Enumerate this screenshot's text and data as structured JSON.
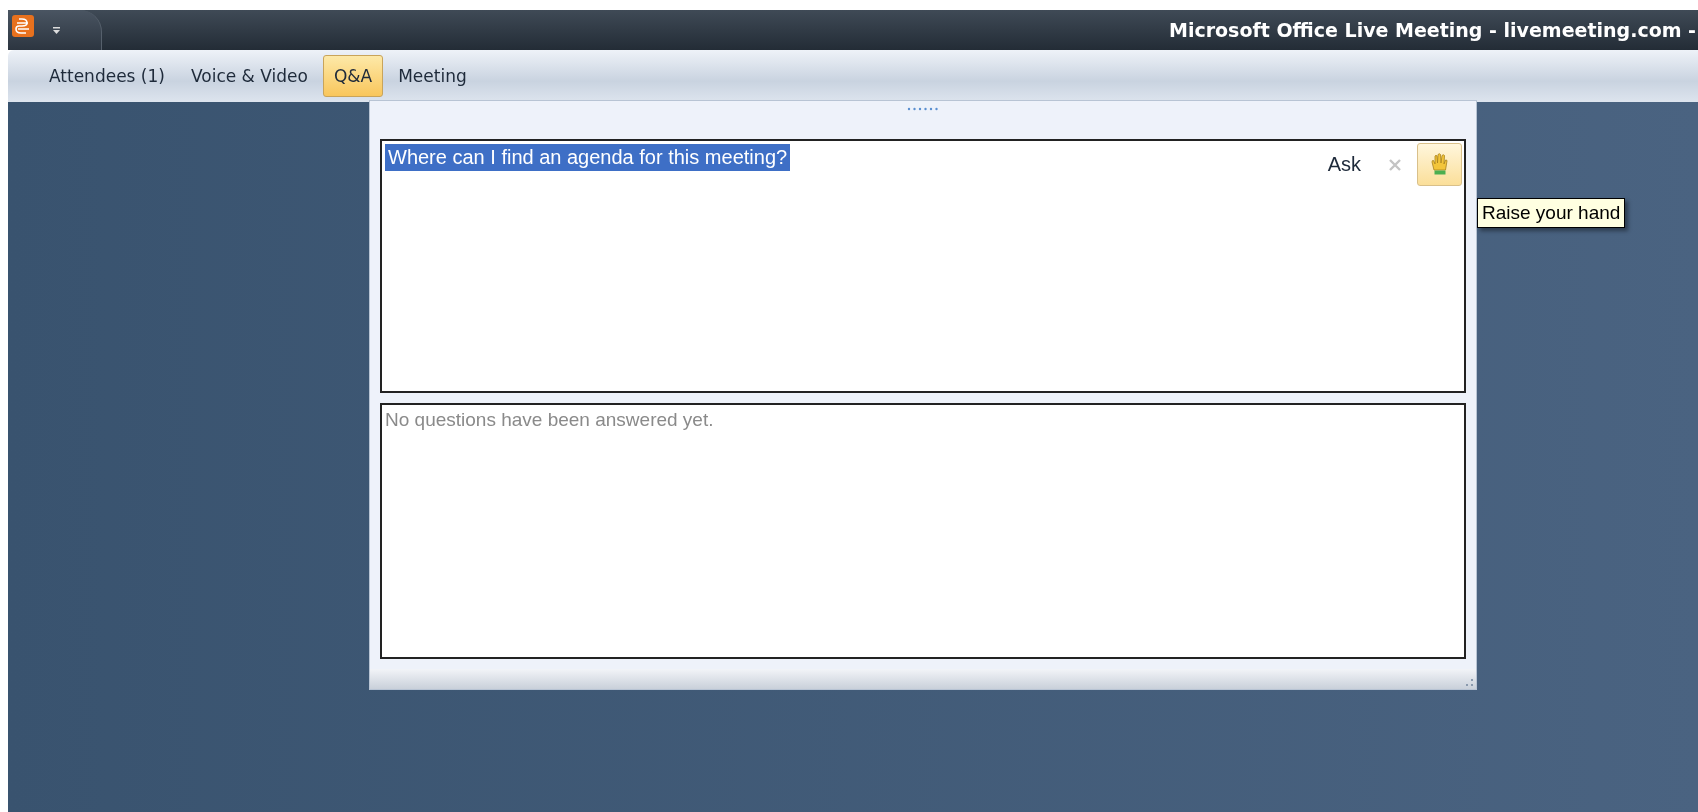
{
  "window": {
    "title": "Microsoft Office Live Meeting - livemeeting.com -"
  },
  "tabs": [
    {
      "label": "Attendees (1)",
      "selected": false
    },
    {
      "label": "Voice & Video",
      "selected": false
    },
    {
      "label": "Q&A",
      "selected": true
    },
    {
      "label": "Meeting",
      "selected": false
    }
  ],
  "qa_panel": {
    "question": {
      "value": "Where can I find an agenda for this meeting?",
      "selected": true
    },
    "ask_label": "Ask",
    "raise_hand": {
      "selected": true,
      "tooltip": "Raise your hand"
    },
    "answered_message": "No questions have been answered yet."
  }
}
